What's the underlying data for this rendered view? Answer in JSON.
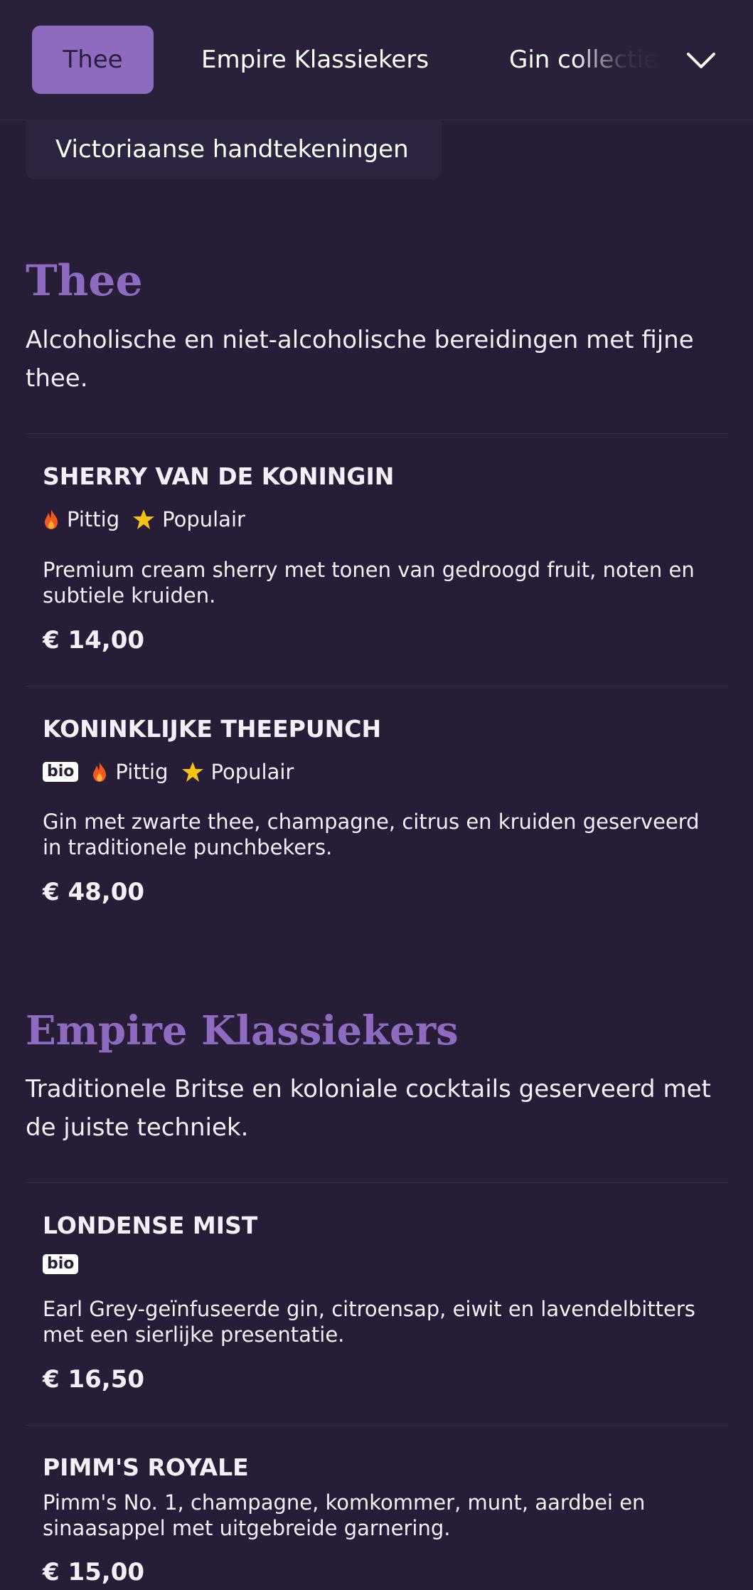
{
  "tabs": [
    "Thee",
    "Empire Klassiekers",
    "Gin collectie"
  ],
  "subcategory": "Victoriaanse handtekeningen",
  "icons": {
    "spicy": "flame-icon",
    "popular": "star-icon",
    "menu": "chevron-down-icon"
  },
  "colors": {
    "accent": "#8e6bc0",
    "background": "#271d37",
    "flame": "#f25b1f",
    "star": "#f5c318"
  },
  "tag_labels": {
    "spicy": "Pittig",
    "popular": "Populair",
    "bio": "bio"
  },
  "sections": [
    {
      "title": "Thee",
      "description": "Alcoholische en niet-alcoholische bereidingen met fijne thee.",
      "items": [
        {
          "name": "SHERRY VAN DE KONINGIN",
          "description": "Premium cream sherry met tonen van gedroogd fruit, noten en subtiele kruiden.",
          "price": "€ 14,00"
        },
        {
          "name": "KONINKLIJKE THEEPUNCH",
          "description": "Gin met zwarte thee, champagne, citrus en kruiden geserveerd in traditionele punchbekers.",
          "price": "€ 48,00"
        }
      ]
    },
    {
      "title": "Empire Klassiekers",
      "description": "Traditionele Britse en koloniale cocktails geserveerd met de juiste techniek.",
      "items": [
        {
          "name": "LONDENSE MIST",
          "description": "Earl Grey-geïnfuseerde gin, citroensap, eiwit en lavendelbitters met een sierlijke presentatie.",
          "price": "€ 16,50"
        },
        {
          "name": "PIMM'S ROYALE",
          "description": "Pimm's No. 1, champagne, komkommer, munt, aardbei en sinaasappel met uitgebreide garnering.",
          "price": "€ 15,00"
        }
      ]
    }
  ]
}
